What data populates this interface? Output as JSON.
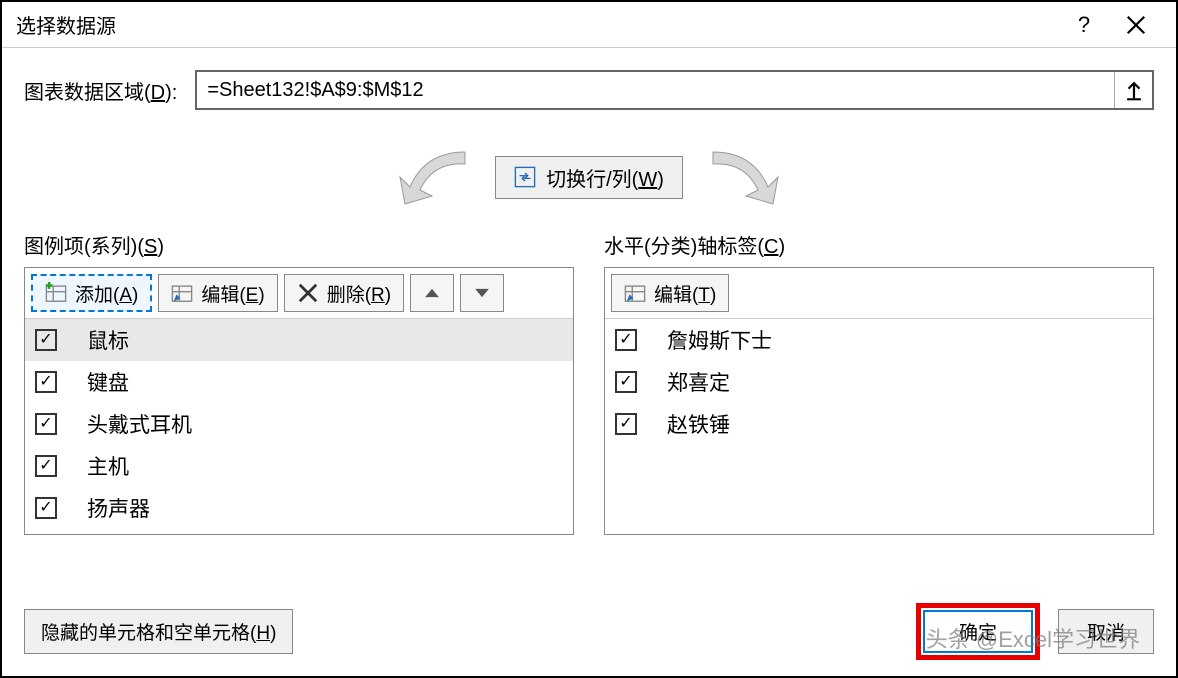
{
  "title": "选择数据源",
  "range_label_pre": "图表数据区域(",
  "range_label_key": "D",
  "range_label_post": "):",
  "range_value": "=Sheet132!$A$9:$M$12",
  "switch_label_pre": "切换行/列(",
  "switch_label_key": "W",
  "switch_label_post": ")",
  "legend_label_pre": "图例项(系列)(",
  "legend_label_key": "S",
  "legend_label_post": ")",
  "axis_label_pre": "水平(分类)轴标签(",
  "axis_label_key": "C",
  "axis_label_post": ")",
  "btn_add_pre": "添加(",
  "btn_add_key": "A",
  "btn_add_post": ")",
  "btn_edit_pre": "编辑(",
  "btn_edit_key": "E",
  "btn_edit_post": ")",
  "btn_remove_pre": "删除(",
  "btn_remove_key": "R",
  "btn_remove_post": ")",
  "btn_edit2_pre": "编辑(",
  "btn_edit2_key": "T",
  "btn_edit2_post": ")",
  "series": [
    "鼠标",
    "键盘",
    "头戴式耳机",
    "主机",
    "扬声器"
  ],
  "categories": [
    "詹姆斯下士",
    "郑喜定",
    "赵铁锤"
  ],
  "hidden_btn_pre": "隐藏的单元格和空单元格(",
  "hidden_btn_key": "H",
  "hidden_btn_post": ")",
  "ok_label": "确定",
  "cancel_label": "取消",
  "watermark": "头条 @Excel学习世界"
}
